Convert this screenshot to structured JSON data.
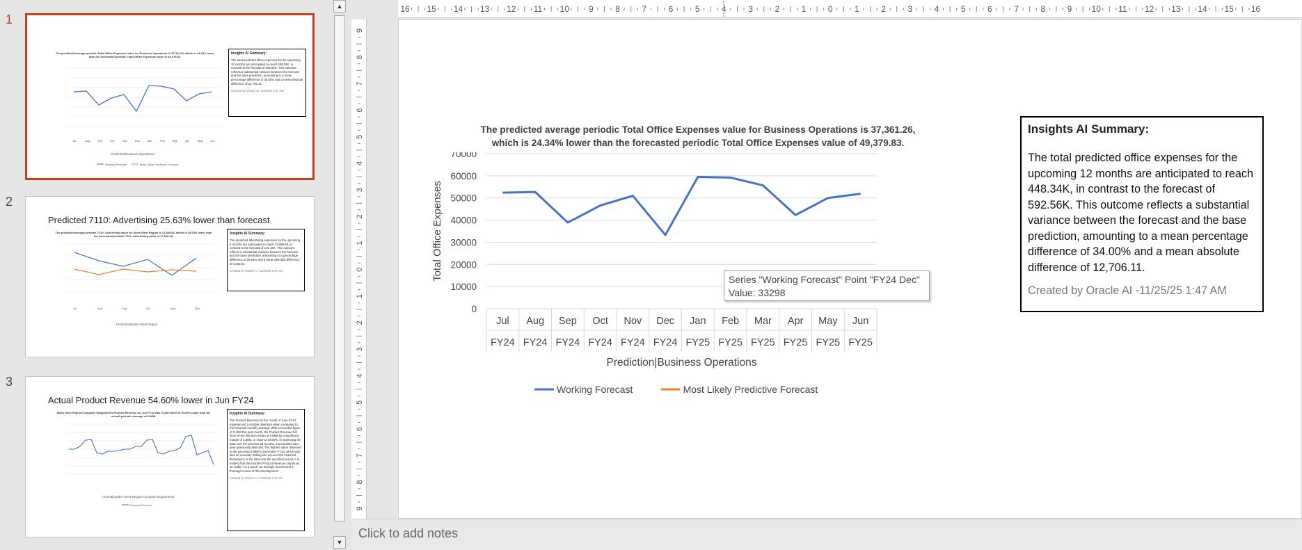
{
  "thumbnails": [
    {
      "number": "1",
      "title": "",
      "chart_title": "The predicted average periodic Total Office Expenses value for Business Operations is 37,361.26, which is 24.34% lower than the forecasted periodic Total Office Expenses value of 49,379.83.",
      "box_head": "Insights AI Summary:",
      "box_body": "The total predicted office expenses for the upcoming 12 months are anticipated to reach 448.34K, in contrast to the forecast of 592.56K. This outcome reflects a substantial variance between the forecast and the base prediction, amounting to a mean percentage difference of 34.00% and a mean absolute difference of 12,706.11.",
      "box_foot": "Created by Oracle AI -11/25/25 1:47 AM"
    },
    {
      "number": "2",
      "title": "Predicted 7110: Advertising 25.63% lower than forecast",
      "chart_title": "The predicted average periodic 7110: Advertising value for Sales West Region is 12,665.83, which is 25.63% lower than the forecasted periodic 7110: Advertising value of 17,028.48.",
      "box_head": "Insights AI Summary:",
      "box_body": "The predicted advertising expenses for the upcoming 6 months are anticipated to reach 75,988.96, in contrast to the forecast of 102.18K. This outcome reflects a substantial variance between the forecast and the base prediction, amounting to a percentage difference of 25.63% and a mean absolute difference of 4,353.52.",
      "box_foot": "Created by Oracle AI -11/25/25 1:57 AM"
    },
    {
      "number": "3",
      "title": "Actual Product Revenue 54.60% lower  in Jun FY24",
      "chart_title": "Sales West Region/Computer Equipment's Product Revenue for Jun FY24 was 3.12M which is 54.60% lower than the overall periodic average of 6.88M.",
      "box_head": "Insights AI Summary:",
      "box_body": "The Product Revenue for the month of June FY24 experienced a notable downturn when compared to the historical monthly average. With a recorded figure of 3.12M this past month, the Product Revenue fell short of the historical mean of 6.88M by a significant margin of 3.55M, or close to 54.60%. In assessing the data over the previous 24 months, 3 anomalies have been previously detected. The highest value observed in the past was 6.95M in December FY23, which was also an anomaly. Taking into account the historical fluctuations in the data over the specified period, it is evident that this month's Product Revenue stands as an outlier. As a result, we strongly recommend a thorough review of this development.",
      "box_foot": "Created by Oracle AI -11/25/25 1:47 AM"
    }
  ],
  "ruler": {
    "h_labels": [
      "16",
      "15",
      "14",
      "13",
      "12",
      "11",
      "10",
      "9",
      "8",
      "7",
      "6",
      "5",
      "4",
      "3",
      "2",
      "1",
      "0",
      "1",
      "2",
      "3",
      "4",
      "5",
      "6",
      "7",
      "8",
      "9",
      "10",
      "11",
      "12",
      "13",
      "14",
      "15",
      "16"
    ],
    "v_labels": [
      "9",
      "8",
      "7",
      "6",
      "5",
      "4",
      "3",
      "2",
      "1",
      "0",
      "1",
      "2",
      "3",
      "4",
      "5",
      "6",
      "7",
      "8",
      "9"
    ]
  },
  "insights": {
    "head": "Insights AI Summary:",
    "body": "The total predicted office expenses for the upcoming 12 months are anticipated to reach 448.34K, in contrast to the forecast of 592.56K. This outcome reflects a substantial variance between the forecast and the base prediction, amounting to a mean percentage difference of 34.00% and a mean absolute difference of 12,706.11.",
    "foot": "Created by Oracle AI -11/25/25 1:47 AM"
  },
  "tooltip": {
    "line1": "Series \"Working Forecast\" Point \"FY24 Dec\"",
    "line2": "Value: 33298"
  },
  "notes": {
    "placeholder": "Click to add notes"
  },
  "scroll": {
    "up": "▲",
    "down": "▼"
  },
  "colors": {
    "series_blue": "#4472c4",
    "series_orange": "#ed7d31",
    "selection": "#c43e1c"
  },
  "chart_data": {
    "type": "line",
    "title": "The predicted average periodic Total Office Expenses value for Business Operations is 37,361.26, which is 24.34% lower than the forecasted periodic Total Office Expenses value of 49,379.83.",
    "ylabel": "Total Office Expenses",
    "xlabel": "Prediction|Business Operations",
    "ylim": [
      0,
      70000
    ],
    "yticks": [
      0,
      10000,
      20000,
      30000,
      40000,
      50000,
      60000,
      70000
    ],
    "categories": [
      {
        "month": "Jul",
        "year": "FY24"
      },
      {
        "month": "Aug",
        "year": "FY24"
      },
      {
        "month": "Sep",
        "year": "FY24"
      },
      {
        "month": "Oct",
        "year": "FY24"
      },
      {
        "month": "Nov",
        "year": "FY24"
      },
      {
        "month": "Dec",
        "year": "FY24"
      },
      {
        "month": "Jan",
        "year": "FY25"
      },
      {
        "month": "Feb",
        "year": "FY25"
      },
      {
        "month": "Mar",
        "year": "FY25"
      },
      {
        "month": "Apr",
        "year": "FY25"
      },
      {
        "month": "May",
        "year": "FY25"
      },
      {
        "month": "Jun",
        "year": "FY25"
      }
    ],
    "series": [
      {
        "name": "Working Forecast",
        "color": "#4472c4",
        "values": [
          52400,
          52700,
          38900,
          46600,
          51000,
          33298,
          59500,
          59200,
          55700,
          42300,
          50000,
          51900
        ]
      },
      {
        "name": "Most Likely Predictive Forecast",
        "color": "#ed7d31",
        "values": []
      }
    ],
    "grid": true,
    "legend": "bottom"
  }
}
